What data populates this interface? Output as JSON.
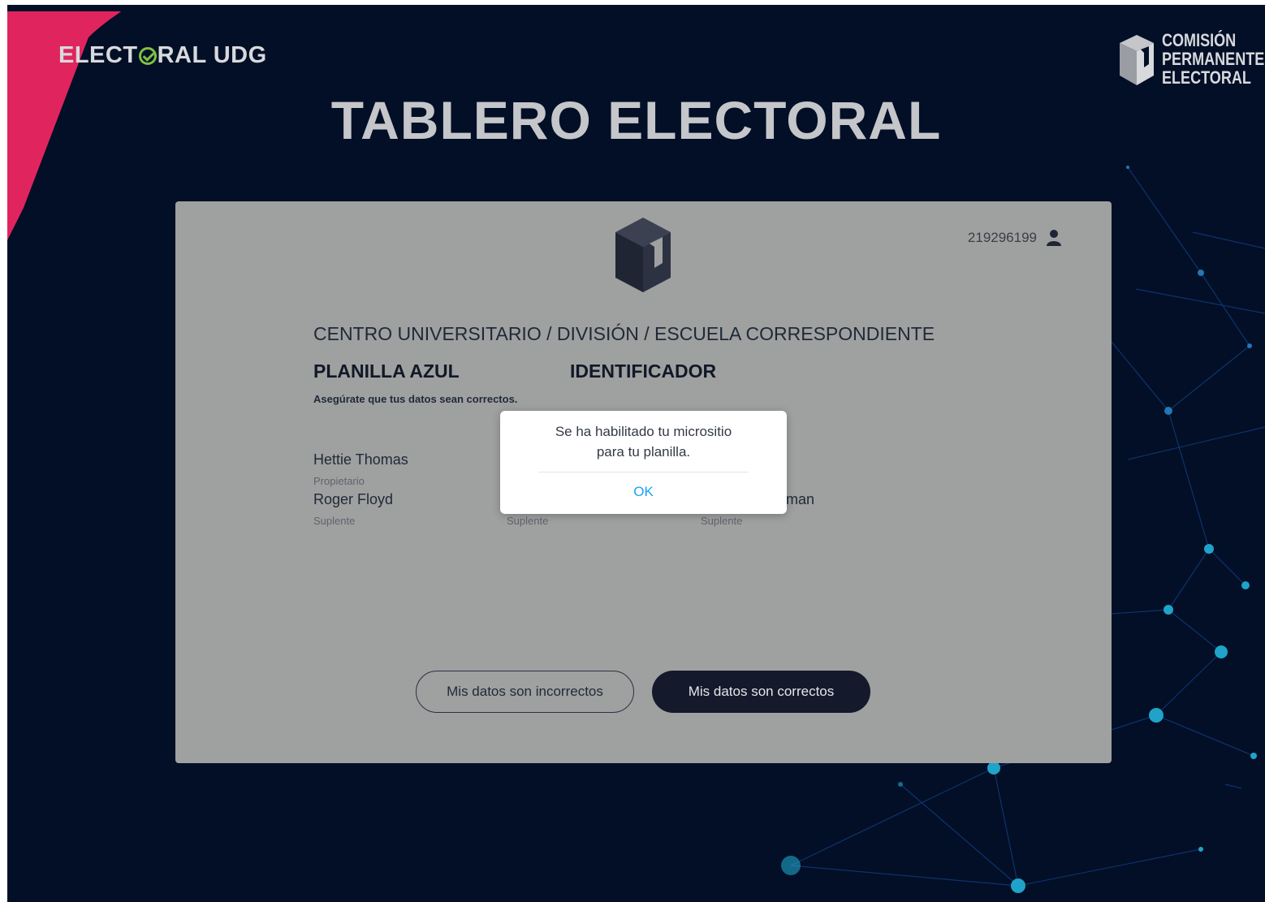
{
  "header": {
    "brand_left_part1": "ELECT",
    "brand_left_part2": "RAL UDG",
    "brand_right_line1": "COMISIÓN",
    "brand_right_line2": "PERMANENTE",
    "brand_right_line3": "ELECTORAL",
    "title": "TABLERO ELECTORAL"
  },
  "card": {
    "user_id": "219296199",
    "user_icon": "user-icon",
    "section_heading": "CENTRO UNIVERSITARIO / DIVISIÓN / ESCUELA CORRESPONDIENTE",
    "planilla": "PLANILLA AZUL",
    "identificador": "IDENTIFICADOR",
    "hint": "Asegúrate que tus datos sean correctos.",
    "members": [
      {
        "name": "Hettie Thomas",
        "role": "Propietario"
      },
      {
        "name": "Roger Floyd",
        "role": "Suplente"
      },
      {
        "name": "",
        "role": "Suplente"
      },
      {
        "name": "dman",
        "role": "Suplente"
      }
    ],
    "btn_incorrect": "Mis datos son incorrectos",
    "btn_correct": "Mis datos son correctos"
  },
  "dialog": {
    "message": "Se ha habilitado tu micrositio para tu planilla.",
    "ok_label": "OK"
  },
  "colors": {
    "background": "#020f26",
    "card": "#9fa0a0",
    "accent_pink": "#e0245e",
    "check_green": "#7cc043",
    "link_blue": "#1da1f2",
    "button_dark": "#141a2b"
  }
}
